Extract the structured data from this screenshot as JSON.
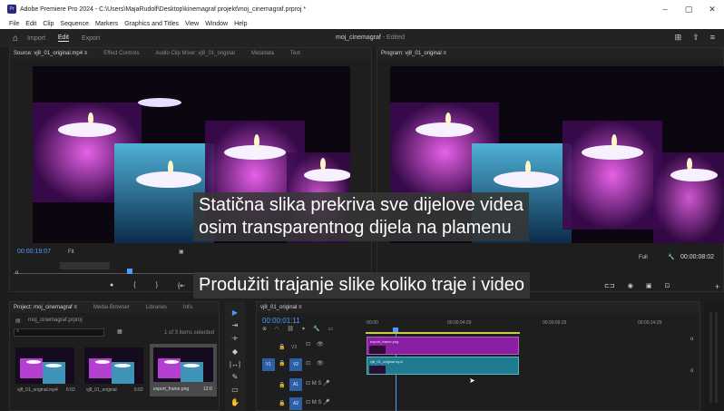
{
  "window": {
    "title": "Adobe Premiere Pro 2024 - C:\\Users\\MajaRudolf\\Desktop\\kinemagraf projekt\\moj_cinemagraf.prproj *",
    "controls": [
      "–",
      "▢",
      "✕"
    ]
  },
  "menu": [
    "File",
    "Edit",
    "Clip",
    "Sequence",
    "Markers",
    "Graphics and Titles",
    "View",
    "Window",
    "Help"
  ],
  "header": {
    "workspaces": [
      "Import",
      "Edit",
      "Export"
    ],
    "active": "Edit",
    "project_name": "moj_cinemagraf",
    "project_state": "- Edited"
  },
  "source_monitor": {
    "tabs": [
      "Source: vj8_01_original.mp4  ≡",
      "Effect Controls",
      "Audio Clip Mixer: vj8_01_original",
      "Metadata",
      "Text"
    ],
    "timecode": "00:00:19:07",
    "fit": "Fit"
  },
  "program_monitor": {
    "tab": "Program: vj8_01_original  ≡",
    "timecode": "00:00:08:02",
    "quality": "Full"
  },
  "caption": {
    "line1": "Statična slika prekriva sve dijelove videa",
    "line2": "osim transparentnog dijela na plamenu",
    "line3": "Produžiti trajanje slike koliko traje i video"
  },
  "project_panel": {
    "tabs": [
      "Project: moj_cinemagraf  ≡",
      "Media Browser",
      "Libraries",
      "Info"
    ],
    "file": "moj_cinemagraf.prproj",
    "selection": "1 of 3 items selected",
    "items": [
      {
        "name": "vj8_01_original.mp4",
        "duration": "6:02"
      },
      {
        "name": "vj8_01_original",
        "duration": "6:02"
      },
      {
        "name": "export_frame.png",
        "duration": "12:0"
      }
    ]
  },
  "timeline": {
    "tab": "vj8_01_original  ≡",
    "timecode": "00:00:01:11",
    "ruler": [
      ":00:00",
      "00:00:04:29",
      "00:00:09:29",
      "00:00:14:29"
    ],
    "tracks": [
      "V3",
      "V2",
      "V1",
      "A1",
      "A2"
    ],
    "clips": {
      "v2": "export_frame.png",
      "v1": "vj8_01_original.mp4"
    }
  },
  "colors": {
    "accent": "#4d9bff",
    "clip_magenta": "#8a1fa3",
    "clip_teal": "#1f7b8f"
  }
}
